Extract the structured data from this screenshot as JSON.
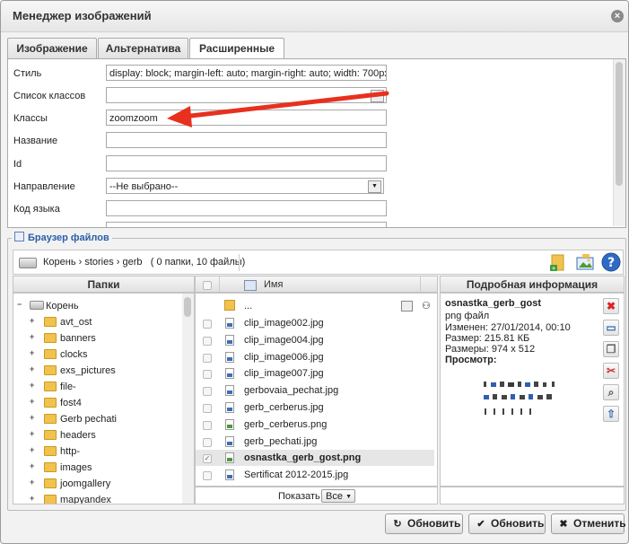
{
  "dialog": {
    "title": "Менеджер изображений",
    "close_label": "×"
  },
  "tabs": [
    {
      "label": "Изображение",
      "active": false
    },
    {
      "label": "Альтернатива",
      "active": false
    },
    {
      "label": "Расширенные",
      "active": true
    }
  ],
  "advanced": {
    "style_label": "Стиль",
    "style_value": "display: block; margin-left: auto; margin-right: auto; width: 700px;",
    "class_list_label": "Список классов",
    "class_list_value": "",
    "classes_label": "Классы",
    "classes_value": "zoomzoom",
    "name_label": "Название",
    "name_value": "",
    "id_label": "Id",
    "id_value": "",
    "direction_label": "Направление",
    "direction_value": "--Не выбрано--",
    "lang_label": "Код языка",
    "lang_value": ""
  },
  "browser": {
    "legend": "Браузер файлов",
    "path": "Корень › stories › gerb",
    "counts": "( 0 папки, 10 файлы)",
    "help_label": "?",
    "folders_header": "Папки",
    "name_header": "Имя",
    "details_header": "Подробная информация",
    "tree_root": "Корень",
    "folders": [
      "avt_ost",
      "banners",
      "clocks",
      "exs_pictures",
      "file-",
      "fost4",
      "Gerb pechati",
      "headers",
      "http-",
      "images",
      "joomgallery",
      "mapyandex"
    ],
    "parent_label": "...",
    "files": [
      {
        "name": "clip_image002.jpg",
        "selected": false
      },
      {
        "name": "clip_image004.jpg",
        "selected": false
      },
      {
        "name": "clip_image006.jpg",
        "selected": false
      },
      {
        "name": "clip_image007.jpg",
        "selected": false
      },
      {
        "name": "gerbovaia_pechat.jpg",
        "selected": false
      },
      {
        "name": "gerb_cerberus.jpg",
        "selected": false
      },
      {
        "name": "gerb_cerberus.png",
        "selected": false
      },
      {
        "name": "gerb_pechati.jpg",
        "selected": false
      },
      {
        "name": "osnastka_gerb_gost.png",
        "selected": true
      },
      {
        "name": "Sertificat 2012-2015.jpg",
        "selected": false
      }
    ],
    "show_label": "Показать",
    "show_value": "Все"
  },
  "details": {
    "filename": "osnastka_gerb_gost",
    "type": "png файл",
    "modified": "Изменен: 27/01/2014, 00:10",
    "size": "Размер: 215.81 КБ",
    "dimensions": "Размеры: 974 x 512",
    "preview_label": "Просмотр:"
  },
  "buttons": {
    "refresh1": "Обновить",
    "refresh2": "Обновить",
    "cancel": "Отменить"
  },
  "colors": {
    "accent_blue": "#2b5ea8",
    "arrow_red": "#e8301f"
  },
  "icons": [
    "close-icon",
    "drive-icon",
    "folder-icon",
    "help-icon",
    "delete-icon",
    "arrow-icon"
  ]
}
